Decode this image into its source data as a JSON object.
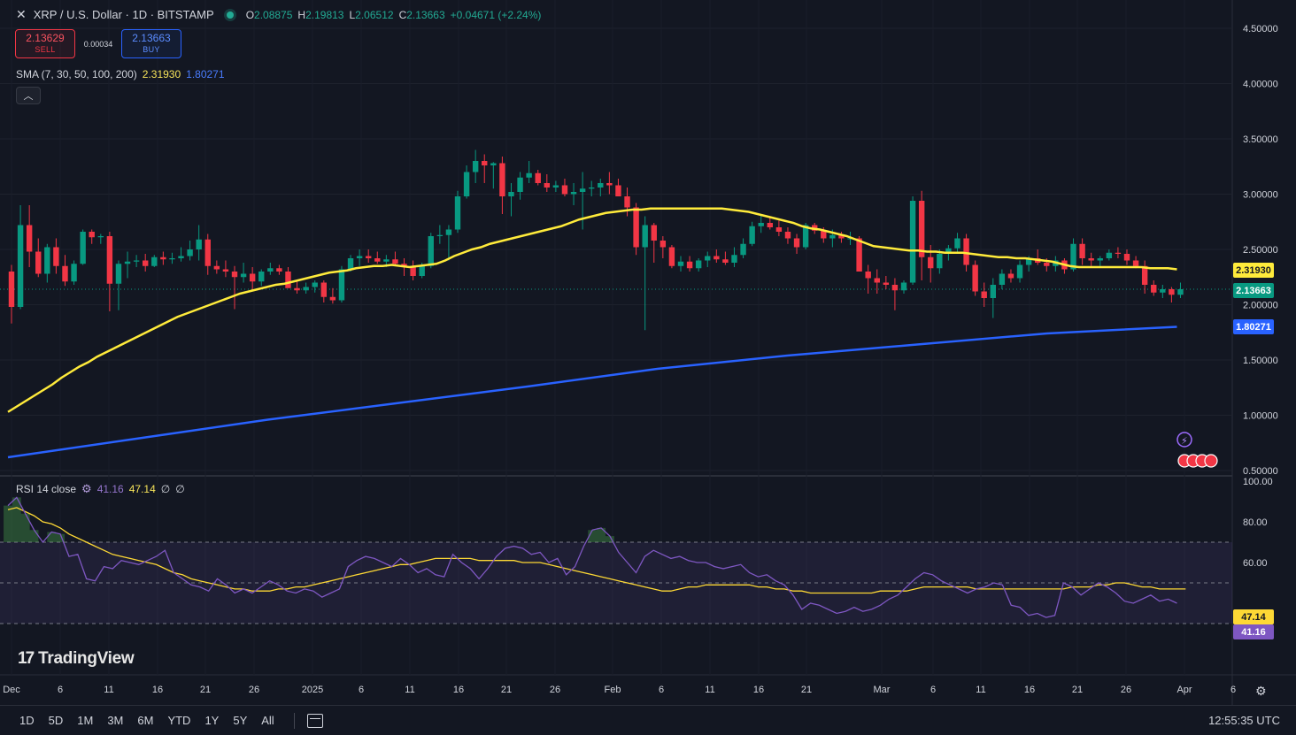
{
  "header": {
    "symbol": "XRP / U.S. Dollar · 1D · BITSTAMP",
    "ohlc": [
      {
        "key": "O",
        "value": "2.08875"
      },
      {
        "key": "H",
        "value": "2.19813"
      },
      {
        "key": "L",
        "value": "2.06512"
      },
      {
        "key": "C",
        "value": "2.13663"
      }
    ],
    "change": "+0.04671 (+2.24%)"
  },
  "trade": {
    "sell_price": "2.13629",
    "sell_label": "SELL",
    "spread": "0.00034",
    "buy_price": "2.13663",
    "buy_label": "BUY"
  },
  "sma_legend": {
    "label": "SMA (7, 30, 50, 100, 200)",
    "value1": "2.31930",
    "value2": "1.80271"
  },
  "rsi_legend": {
    "label": "RSI 14 close",
    "value1": "41.16",
    "value2": "47.14",
    "extra1": "∅",
    "extra2": "∅"
  },
  "price_tags": {
    "sma50": "2.31930",
    "last": "2.13663",
    "sma200": "1.80271",
    "rsi": "41.16",
    "rsi_ma": "47.14"
  },
  "logo": "TradingView",
  "ranges": [
    "1D",
    "5D",
    "1M",
    "3M",
    "6M",
    "YTD",
    "1Y",
    "5Y",
    "All"
  ],
  "clock": "12:55:35 UTC",
  "colors": {
    "up": "#089981",
    "down": "#f23645",
    "sma50": "#ffeb3b",
    "sma200": "#2962ff",
    "rsi": "#7e57c2",
    "rsi_ma": "#fdd835"
  },
  "chart_data": [
    {
      "type": "candlestick",
      "ylim": [
        0.5,
        4.5
      ],
      "y_ticks": [
        "4.50000",
        "4.00000",
        "3.50000",
        "3.00000",
        "2.50000",
        "2.00000",
        "1.50000",
        "1.00000",
        "0.50000"
      ],
      "x_ticks": [
        "Dec",
        "6",
        "11",
        "16",
        "21",
        "26",
        "2025",
        "6",
        "11",
        "16",
        "21",
        "26",
        "Feb",
        "6",
        "11",
        "16",
        "21",
        "Mar",
        "6",
        "11",
        "16",
        "21",
        "26",
        "Apr",
        "6"
      ],
      "candles": [
        [
          2.3,
          2.36,
          1.83,
          1.98
        ],
        [
          1.98,
          2.9,
          1.96,
          2.72
        ],
        [
          2.72,
          2.9,
          2.34,
          2.48
        ],
        [
          2.48,
          2.6,
          2.25,
          2.28
        ],
        [
          2.28,
          2.55,
          2.2,
          2.52
        ],
        [
          2.52,
          2.6,
          2.28,
          2.35
        ],
        [
          2.35,
          2.45,
          2.17,
          2.21
        ],
        [
          2.21,
          2.4,
          2.18,
          2.37
        ],
        [
          2.37,
          2.68,
          2.36,
          2.66
        ],
        [
          2.66,
          2.68,
          2.55,
          2.61
        ],
        [
          2.61,
          2.64,
          2.55,
          2.62
        ],
        [
          2.62,
          2.66,
          1.94,
          2.19
        ],
        [
          2.19,
          2.4,
          1.95,
          2.37
        ],
        [
          2.37,
          2.48,
          2.24,
          2.39
        ],
        [
          2.39,
          2.45,
          2.34,
          2.4
        ],
        [
          2.4,
          2.46,
          2.3,
          2.35
        ],
        [
          2.35,
          2.45,
          2.34,
          2.43
        ],
        [
          2.43,
          2.48,
          2.36,
          2.41
        ],
        [
          2.41,
          2.47,
          2.37,
          2.42
        ],
        [
          2.42,
          2.52,
          2.39,
          2.44
        ],
        [
          2.44,
          2.58,
          2.4,
          2.5
        ],
        [
          2.5,
          2.72,
          2.4,
          2.59
        ],
        [
          2.59,
          2.64,
          2.27,
          2.35
        ],
        [
          2.35,
          2.4,
          2.28,
          2.32
        ],
        [
          2.32,
          2.4,
          2.25,
          2.3
        ],
        [
          2.3,
          2.35,
          1.96,
          2.25
        ],
        [
          2.25,
          2.38,
          2.2,
          2.28
        ],
        [
          2.28,
          2.34,
          2.12,
          2.21
        ],
        [
          2.21,
          2.32,
          2.17,
          2.3
        ],
        [
          2.3,
          2.38,
          2.27,
          2.33
        ],
        [
          2.33,
          2.36,
          2.27,
          2.3
        ],
        [
          2.3,
          2.34,
          2.18,
          2.15
        ],
        [
          2.15,
          2.22,
          2.1,
          2.13
        ],
        [
          2.13,
          2.2,
          2.1,
          2.16
        ],
        [
          2.16,
          2.22,
          2.11,
          2.2
        ],
        [
          2.2,
          2.22,
          2.02,
          2.07
        ],
        [
          2.07,
          2.15,
          2.01,
          2.04
        ],
        [
          2.04,
          2.35,
          2.02,
          2.32
        ],
        [
          2.32,
          2.45,
          2.3,
          2.42
        ],
        [
          2.42,
          2.5,
          2.35,
          2.44
        ],
        [
          2.44,
          2.5,
          2.38,
          2.42
        ],
        [
          2.42,
          2.48,
          2.37,
          2.39
        ],
        [
          2.39,
          2.45,
          2.34,
          2.41
        ],
        [
          2.41,
          2.48,
          2.35,
          2.37
        ],
        [
          2.37,
          2.42,
          2.26,
          2.34
        ],
        [
          2.34,
          2.4,
          2.22,
          2.26
        ],
        [
          2.26,
          2.38,
          2.24,
          2.35
        ],
        [
          2.35,
          2.65,
          2.33,
          2.62
        ],
        [
          2.62,
          2.72,
          2.55,
          2.63
        ],
        [
          2.63,
          2.72,
          2.4,
          2.68
        ],
        [
          2.68,
          3.03,
          2.65,
          2.98
        ],
        [
          2.98,
          3.26,
          2.96,
          3.2
        ],
        [
          3.2,
          3.4,
          3.1,
          3.3
        ],
        [
          3.3,
          3.36,
          3.1,
          3.26
        ],
        [
          3.26,
          3.29,
          3.05,
          3.28
        ],
        [
          3.28,
          3.34,
          2.82,
          2.98
        ],
        [
          2.98,
          3.1,
          2.8,
          3.02
        ],
        [
          3.02,
          3.2,
          2.95,
          3.15
        ],
        [
          3.15,
          3.3,
          3.1,
          3.19
        ],
        [
          3.19,
          3.22,
          3.08,
          3.1
        ],
        [
          3.1,
          3.18,
          3.02,
          3.06
        ],
        [
          3.06,
          3.12,
          3.02,
          3.08
        ],
        [
          3.08,
          3.14,
          2.98,
          3.0
        ],
        [
          3.0,
          3.1,
          2.9,
          3.02
        ],
        [
          3.02,
          3.2,
          2.68,
          3.05
        ],
        [
          3.05,
          3.12,
          2.98,
          3.06
        ],
        [
          3.06,
          3.14,
          2.98,
          3.1
        ],
        [
          3.1,
          3.2,
          3.0,
          3.08
        ],
        [
          3.08,
          3.14,
          3.0,
          2.98
        ],
        [
          2.98,
          3.06,
          2.8,
          2.88
        ],
        [
          2.88,
          2.92,
          2.45,
          2.52
        ],
        [
          2.52,
          2.8,
          1.77,
          2.72
        ],
        [
          2.72,
          2.74,
          2.38,
          2.58
        ],
        [
          2.58,
          2.62,
          2.42,
          2.52
        ],
        [
          2.52,
          2.54,
          2.33,
          2.35
        ],
        [
          2.35,
          2.44,
          2.3,
          2.39
        ],
        [
          2.39,
          2.44,
          2.3,
          2.33
        ],
        [
          2.33,
          2.42,
          2.3,
          2.4
        ],
        [
          2.4,
          2.48,
          2.34,
          2.44
        ],
        [
          2.44,
          2.5,
          2.38,
          2.41
        ],
        [
          2.41,
          2.48,
          2.36,
          2.38
        ],
        [
          2.38,
          2.52,
          2.34,
          2.45
        ],
        [
          2.45,
          2.6,
          2.42,
          2.55
        ],
        [
          2.55,
          2.75,
          2.53,
          2.71
        ],
        [
          2.71,
          2.82,
          2.65,
          2.74
        ],
        [
          2.74,
          2.8,
          2.68,
          2.7
        ],
        [
          2.7,
          2.76,
          2.62,
          2.66
        ],
        [
          2.66,
          2.7,
          2.55,
          2.6
        ],
        [
          2.6,
          2.64,
          2.46,
          2.52
        ],
        [
          2.52,
          2.74,
          2.5,
          2.72
        ],
        [
          2.72,
          2.74,
          2.64,
          2.67
        ],
        [
          2.67,
          2.7,
          2.56,
          2.6
        ],
        [
          2.6,
          2.68,
          2.52,
          2.63
        ],
        [
          2.63,
          2.66,
          2.56,
          2.6
        ],
        [
          2.6,
          2.66,
          2.54,
          2.6
        ],
        [
          2.6,
          2.62,
          2.32,
          2.3
        ],
        [
          2.3,
          2.36,
          2.1,
          2.24
        ],
        [
          2.24,
          2.32,
          2.1,
          2.2
        ],
        [
          2.2,
          2.26,
          2.14,
          2.18
        ],
        [
          2.18,
          2.24,
          1.95,
          2.13
        ],
        [
          2.13,
          2.22,
          2.1,
          2.2
        ],
        [
          2.2,
          2.98,
          2.18,
          2.94
        ],
        [
          2.94,
          3.03,
          2.22,
          2.43
        ],
        [
          2.43,
          2.54,
          2.2,
          2.33
        ],
        [
          2.33,
          2.5,
          2.28,
          2.46
        ],
        [
          2.46,
          2.54,
          2.4,
          2.51
        ],
        [
          2.51,
          2.65,
          2.48,
          2.6
        ],
        [
          2.6,
          2.64,
          2.3,
          2.36
        ],
        [
          2.36,
          2.4,
          2.08,
          2.12
        ],
        [
          2.12,
          2.2,
          1.98,
          2.06
        ],
        [
          2.06,
          2.24,
          1.88,
          2.18
        ],
        [
          2.18,
          2.32,
          2.14,
          2.28
        ],
        [
          2.28,
          2.32,
          2.2,
          2.24
        ],
        [
          2.24,
          2.4,
          2.2,
          2.36
        ],
        [
          2.36,
          2.44,
          2.3,
          2.42
        ],
        [
          2.42,
          2.5,
          2.36,
          2.38
        ],
        [
          2.38,
          2.42,
          2.3,
          2.35
        ],
        [
          2.35,
          2.44,
          2.3,
          2.4
        ],
        [
          2.4,
          2.42,
          2.28,
          2.32
        ],
        [
          2.32,
          2.6,
          2.3,
          2.55
        ],
        [
          2.55,
          2.6,
          2.36,
          2.42
        ],
        [
          2.42,
          2.47,
          2.35,
          2.4
        ],
        [
          2.4,
          2.44,
          2.35,
          2.42
        ],
        [
          2.42,
          2.5,
          2.4,
          2.47
        ],
        [
          2.47,
          2.52,
          2.42,
          2.46
        ],
        [
          2.46,
          2.5,
          2.36,
          2.4
        ],
        [
          2.4,
          2.44,
          2.33,
          2.35
        ],
        [
          2.35,
          2.4,
          2.1,
          2.18
        ],
        [
          2.18,
          2.22,
          2.08,
          2.11
        ],
        [
          2.11,
          2.18,
          2.06,
          2.14
        ],
        [
          2.14,
          2.16,
          2.02,
          2.09
        ],
        [
          2.09,
          2.2,
          2.06,
          2.14
        ]
      ],
      "sma50": [
        1.03,
        1.08,
        1.13,
        1.18,
        1.23,
        1.28,
        1.34,
        1.39,
        1.44,
        1.48,
        1.53,
        1.57,
        1.61,
        1.65,
        1.69,
        1.73,
        1.77,
        1.81,
        1.85,
        1.89,
        1.92,
        1.95,
        1.98,
        2.01,
        2.04,
        2.07,
        2.1,
        2.12,
        2.14,
        2.16,
        2.18,
        2.19,
        2.21,
        2.23,
        2.25,
        2.27,
        2.29,
        2.3,
        2.31,
        2.33,
        2.34,
        2.35,
        2.35,
        2.36,
        2.35,
        2.34,
        2.35,
        2.36,
        2.37,
        2.4,
        2.44,
        2.47,
        2.5,
        2.52,
        2.55,
        2.57,
        2.59,
        2.61,
        2.63,
        2.65,
        2.67,
        2.69,
        2.71,
        2.74,
        2.77,
        2.79,
        2.81,
        2.83,
        2.84,
        2.85,
        2.86,
        2.86,
        2.87,
        2.87,
        2.87,
        2.87,
        2.87,
        2.87,
        2.87,
        2.87,
        2.87,
        2.86,
        2.85,
        2.84,
        2.82,
        2.8,
        2.78,
        2.76,
        2.74,
        2.71,
        2.69,
        2.68,
        2.66,
        2.64,
        2.62,
        2.59,
        2.56,
        2.53,
        2.52,
        2.51,
        2.5,
        2.49,
        2.49,
        2.48,
        2.48,
        2.47,
        2.47,
        2.47,
        2.46,
        2.45,
        2.44,
        2.43,
        2.43,
        2.42,
        2.42,
        2.41,
        2.4,
        2.39,
        2.37,
        2.35,
        2.34,
        2.34,
        2.34,
        2.34,
        2.34,
        2.34,
        2.34,
        2.34,
        2.33,
        2.33,
        2.33,
        2.32
      ],
      "sma200": [
        0.62,
        0.79,
        0.96,
        1.11,
        1.26,
        1.42,
        1.54,
        1.64,
        1.74,
        1.8
      ]
    },
    {
      "type": "line",
      "title": "RSI 14 close",
      "ylim": [
        0,
        100
      ],
      "y_ticks": [
        "100.00",
        "80.00",
        "60.00"
      ],
      "bands": [
        30,
        50,
        70
      ],
      "rsi": [
        88,
        92,
        84,
        76,
        70,
        75,
        74,
        63,
        64,
        52,
        51,
        58,
        57,
        61,
        60,
        59,
        61,
        63,
        66,
        55,
        52,
        49,
        48,
        46,
        52,
        49,
        45,
        47,
        45,
        48,
        51,
        49,
        46,
        45,
        47,
        46,
        43,
        45,
        47,
        58,
        61,
        63,
        62,
        60,
        58,
        62,
        59,
        55,
        57,
        54,
        53,
        64,
        60,
        57,
        52,
        57,
        63,
        67,
        68,
        67,
        64,
        65,
        60,
        62,
        54,
        58,
        68,
        76,
        77,
        73,
        65,
        60,
        55,
        63,
        66,
        64,
        62,
        63,
        61,
        60,
        60,
        58,
        57,
        58,
        59,
        55,
        53,
        54,
        51,
        49,
        44,
        37,
        40,
        39,
        37,
        35,
        36,
        38,
        36,
        37,
        39,
        42,
        44,
        48,
        52,
        55,
        54,
        51,
        49,
        47,
        45,
        47,
        48,
        50,
        49,
        39,
        38,
        34,
        35,
        33,
        34,
        50,
        48,
        44,
        47,
        50,
        48,
        45,
        41,
        40,
        42,
        44,
        41,
        42,
        40
      ],
      "rsi_ma": [
        86,
        87,
        85,
        83,
        80,
        79,
        77,
        74,
        72,
        70,
        68,
        66,
        64,
        63,
        62,
        61,
        60,
        59,
        57,
        55,
        54,
        52,
        51,
        50,
        49,
        48,
        47,
        47,
        46,
        46,
        46,
        47,
        47,
        48,
        48,
        49,
        50,
        51,
        52,
        53,
        54,
        55,
        56,
        57,
        58,
        59,
        59,
        60,
        61,
        62,
        62,
        62,
        62,
        62,
        61,
        61,
        61,
        61,
        61,
        60,
        60,
        60,
        59,
        58,
        57,
        56,
        55,
        54,
        53,
        52,
        51,
        50,
        49,
        48,
        47,
        46,
        46,
        47,
        48,
        48,
        49,
        49,
        49,
        49,
        49,
        49,
        48,
        48,
        47,
        47,
        46,
        46,
        45,
        45,
        45,
        45,
        45,
        45,
        45,
        45,
        46,
        46,
        46,
        46,
        47,
        48,
        48,
        48,
        48,
        48,
        48,
        47,
        47,
        47,
        47,
        47,
        47,
        47,
        47,
        47,
        47,
        47,
        48,
        48,
        48,
        49,
        49,
        50,
        50,
        49,
        48,
        48,
        47,
        47,
        47,
        47
      ]
    }
  ]
}
